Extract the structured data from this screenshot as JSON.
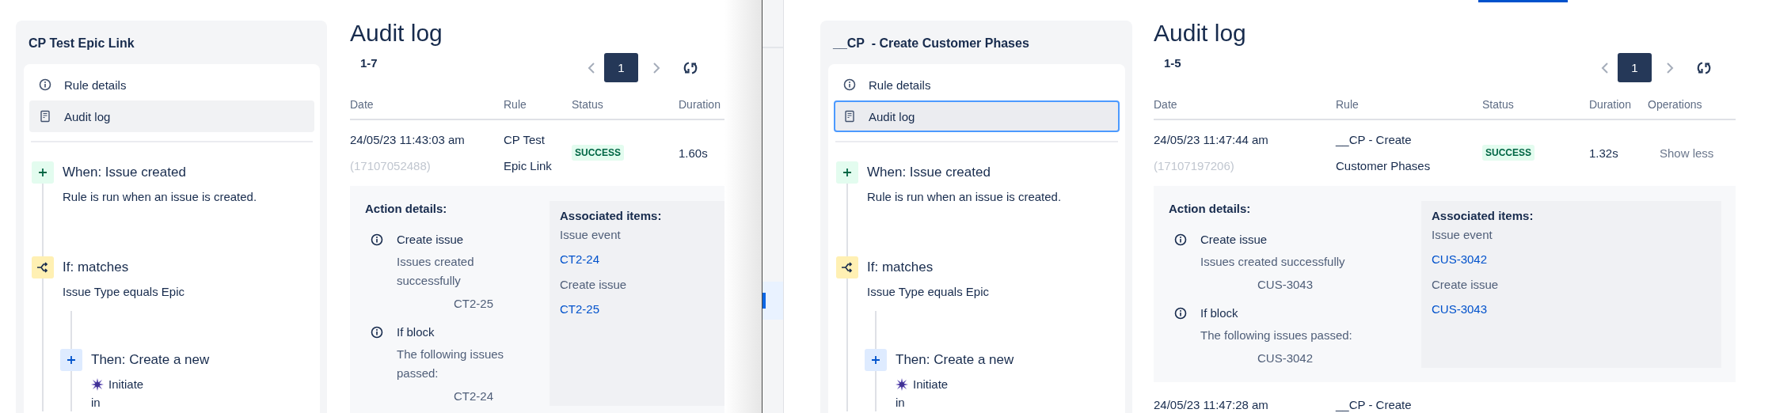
{
  "windows": [
    {
      "rule_panel": {
        "title": "CP Test Epic Link",
        "nav": [
          {
            "label": "Rule details",
            "selected": false,
            "focused": false
          },
          {
            "label": "Audit log",
            "selected": true,
            "focused": false
          }
        ],
        "steps": [
          {
            "kind": "trigger",
            "title": "When: Issue created",
            "description": "Rule is run when an issue is created."
          },
          {
            "kind": "condition",
            "title": "If: matches",
            "description": "Issue Type equals Epic",
            "children": [
              {
                "kind": "action",
                "title": "Then: Create a new",
                "issue_type": "Initiate",
                "description": "in"
              }
            ]
          }
        ]
      },
      "audit_log": {
        "title": "Audit log",
        "range": "1-7",
        "pages": [
          {
            "label": "1",
            "selected": true
          }
        ],
        "columns": [
          "Date",
          "Rule",
          "Status",
          "Duration"
        ],
        "rows": [
          {
            "date": "24/05/23 11:43:03 am",
            "id": "(17107052488)",
            "rule": "CP Test Epic Link",
            "status": "SUCCESS",
            "duration": "1.60s",
            "details": {
              "heading": "Action details:",
              "actions": [
                {
                  "title": "Create issue",
                  "message": "Issues created successfully",
                  "issue": "CT2-25"
                },
                {
                  "title": "If block",
                  "message": "The following issues passed:",
                  "issue": "CT2-24"
                }
              ],
              "associated": {
                "heading": "Associated items:",
                "groups": [
                  {
                    "label": "Issue event",
                    "issue": "CT2-24"
                  },
                  {
                    "label": "Create issue",
                    "issue": "CT2-25"
                  }
                ]
              }
            }
          }
        ]
      }
    },
    {
      "top_tab": {
        "selected": true
      },
      "sidebar": {
        "items": [
          {
            "selected": true
          }
        ]
      },
      "rule_panel": {
        "title": "__CP  - Create Customer Phases",
        "nav": [
          {
            "label": "Rule details",
            "selected": false,
            "focused": false
          },
          {
            "label": "Audit log",
            "selected": true,
            "focused": true
          }
        ],
        "steps": [
          {
            "kind": "trigger",
            "title": "When: Issue created",
            "description": "Rule is run when an issue is created."
          },
          {
            "kind": "condition",
            "title": "If: matches",
            "description": "Issue Type equals Epic",
            "children": [
              {
                "kind": "action",
                "title": "Then: Create a new",
                "issue_type": "Initiate",
                "description": "in"
              }
            ]
          }
        ]
      },
      "audit_log": {
        "title": "Audit log",
        "range": "1-5",
        "pages": [
          {
            "label": "1",
            "selected": true
          }
        ],
        "columns": [
          "Date",
          "Rule",
          "Status",
          "Duration",
          "Operations"
        ],
        "rows": [
          {
            "date": "24/05/23 11:47:44 am",
            "id": "(17107197206)",
            "rule": "__CP - Create Customer Phases",
            "status": "SUCCESS",
            "duration": "1.32s",
            "operation": "Show less",
            "details": {
              "heading": "Action details:",
              "actions": [
                {
                  "title": "Create issue",
                  "message": "Issues created successfully",
                  "issue": "CUS-3043"
                },
                {
                  "title": "If block",
                  "message": "The following issues passed:",
                  "issue": "CUS-3042"
                }
              ],
              "associated": {
                "heading": "Associated items:",
                "groups": [
                  {
                    "label": "Issue event",
                    "issue": "CUS-3042"
                  },
                  {
                    "label": "Create issue",
                    "issue": "CUS-3043"
                  }
                ]
              }
            }
          },
          {
            "date": "24/05/23 11:47:28 am",
            "rule": "__CP - Create"
          }
        ]
      }
    }
  ]
}
